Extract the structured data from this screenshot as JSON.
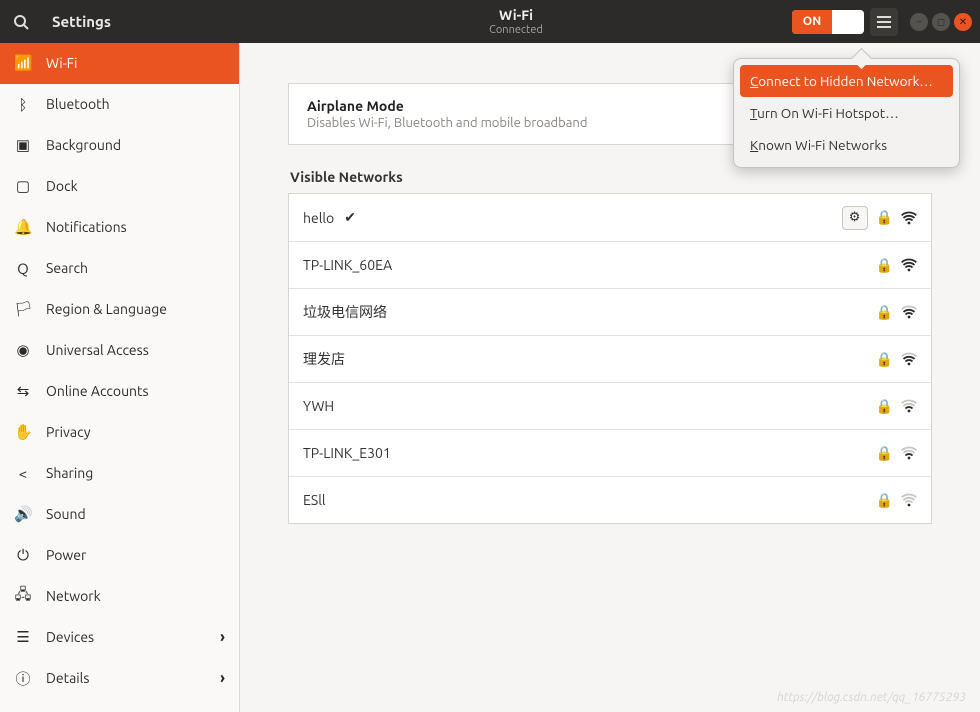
{
  "header": {
    "app_title": "Settings",
    "page_title": "Wi-Fi",
    "subtitle": "Connected",
    "toggle_on": "ON"
  },
  "sidebar": {
    "items": [
      {
        "icon": "📶",
        "label": "Wi-Fi",
        "active": true
      },
      {
        "icon": "ᛒ",
        "label": "Bluetooth"
      },
      {
        "icon": "▣",
        "label": "Background"
      },
      {
        "icon": "▢",
        "label": "Dock"
      },
      {
        "icon": "🔔",
        "label": "Notifications"
      },
      {
        "icon": "Q",
        "label": "Search"
      },
      {
        "icon": "🏳",
        "label": "Region & Language"
      },
      {
        "icon": "◉",
        "label": "Universal Access"
      },
      {
        "icon": "⇆",
        "label": "Online Accounts"
      },
      {
        "icon": "✋",
        "label": "Privacy"
      },
      {
        "icon": "<",
        "label": "Sharing"
      },
      {
        "icon": "🔊",
        "label": "Sound"
      },
      {
        "icon": "⏻",
        "label": "Power"
      },
      {
        "icon": "🖧",
        "label": "Network"
      },
      {
        "icon": "☰",
        "label": "Devices",
        "chev": true
      },
      {
        "icon": "ⓘ",
        "label": "Details",
        "chev": true
      }
    ]
  },
  "airplane": {
    "title": "Airplane Mode",
    "desc": "Disables Wi-Fi, Bluetooth and mobile broadband"
  },
  "networks": {
    "heading": "Visible Networks",
    "list": [
      {
        "name": "hello",
        "connected": true,
        "secure": true,
        "strength": 4,
        "gear": true
      },
      {
        "name": "TP-LINK_60EA",
        "secure": true,
        "strength": 4
      },
      {
        "name": "垃圾电信网络",
        "secure": true,
        "strength": 3
      },
      {
        "name": "理发店",
        "secure": true,
        "strength": 3
      },
      {
        "name": "YWH",
        "secure": true,
        "strength": 2
      },
      {
        "name": "TP-LINK_E301",
        "secure": true,
        "strength": 2
      },
      {
        "name": "ESll",
        "secure": true,
        "strength": 1
      }
    ]
  },
  "popover": {
    "items": [
      {
        "label": "Connect to Hidden Network…",
        "u": 0,
        "active": true
      },
      {
        "label": "Turn On Wi-Fi Hotspot…",
        "u": 0
      },
      {
        "label": "Known Wi-Fi Networks",
        "u": 0
      }
    ]
  },
  "watermark": "https://blog.csdn.net/qq_16775293"
}
